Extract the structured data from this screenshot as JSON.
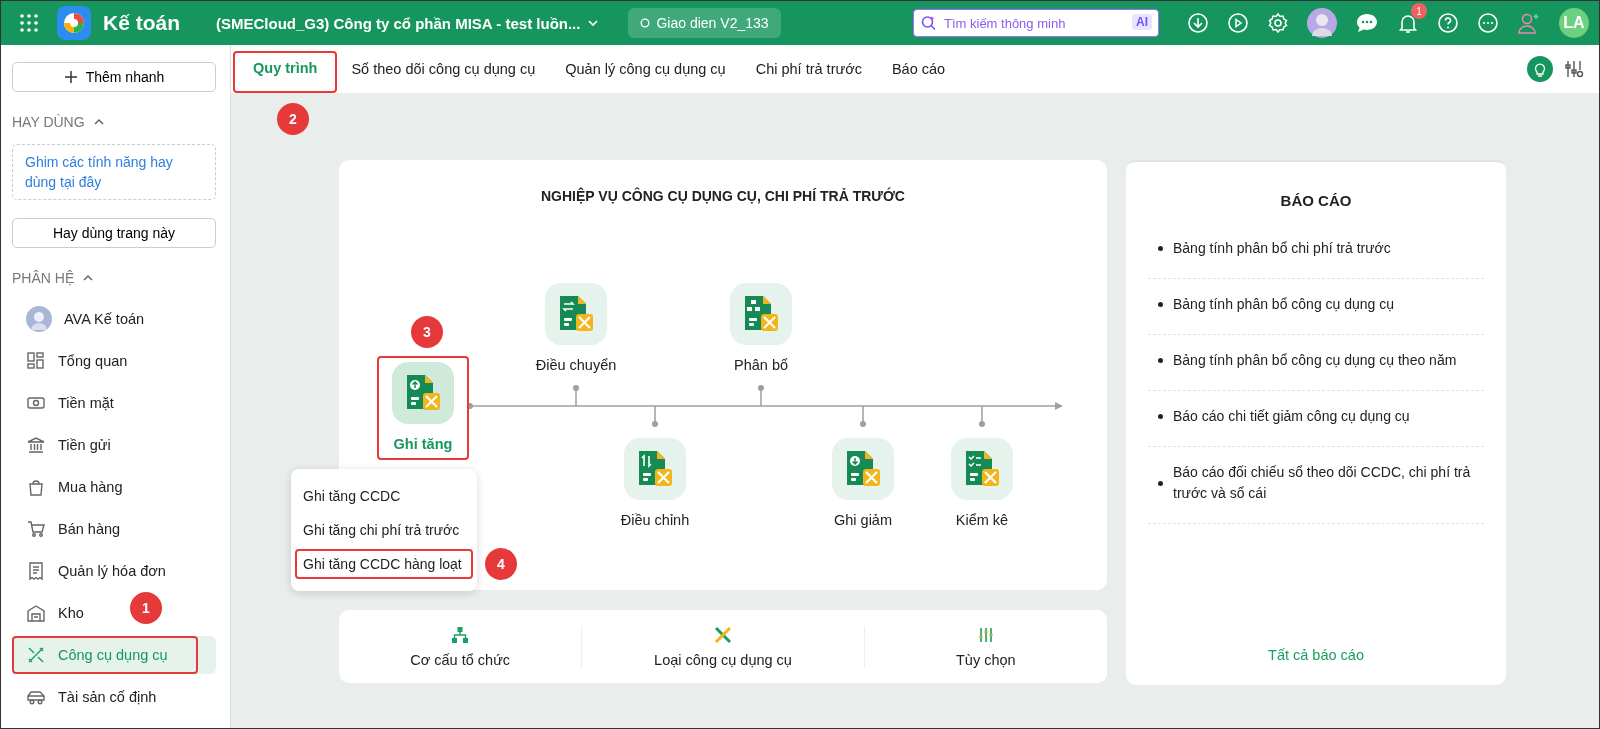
{
  "app": {
    "title": "Kế toán",
    "company": "(SMECloud_G3) Công ty cổ phần MISA - test luồn...",
    "version": "Giao dien V2_133"
  },
  "search": {
    "placeholder": "Tìm kiếm thông minh",
    "badge": "AI"
  },
  "notifications": {
    "count": "1"
  },
  "user": {
    "initials": "LA"
  },
  "sidebar": {
    "quick_add": "Thêm nhanh",
    "favorites": {
      "heading": "HAY DÙNG",
      "expanded": true,
      "hint": "Ghim các tính năng hay dùng tại đây",
      "button": "Hay dùng trang này"
    },
    "modules": {
      "heading": "PHÂN HỆ",
      "expanded": true,
      "items": [
        {
          "label": "AVA Kế toán",
          "selected": false
        },
        {
          "label": "Tổng quan",
          "selected": false
        },
        {
          "label": "Tiền mặt",
          "selected": false
        },
        {
          "label": "Tiền gửi",
          "selected": false
        },
        {
          "label": "Mua hàng",
          "selected": false
        },
        {
          "label": "Bán hàng",
          "selected": false
        },
        {
          "label": "Quản lý hóa đơn",
          "selected": false
        },
        {
          "label": "Kho",
          "selected": false
        },
        {
          "label": "Công cụ dụng cụ",
          "selected": true,
          "callout": "1"
        },
        {
          "label": "Tài sản cố định",
          "selected": false
        }
      ]
    }
  },
  "tabs": [
    {
      "label": "Quy trình",
      "selected": true,
      "callout": "2"
    },
    {
      "label": "Sổ theo dõi công cụ dụng cụ",
      "selected": false
    },
    {
      "label": "Quản lý công cụ dụng cụ",
      "selected": false
    },
    {
      "label": "Chi phí trả trước",
      "selected": false
    },
    {
      "label": "Báo cáo",
      "selected": false
    }
  ],
  "process": {
    "title": "NGHIỆP VỤ CÔNG CỤ DỤNG CỤ, CHI PHÍ TRẢ TRƯỚC",
    "nodes": [
      {
        "label": "Ghi tăng",
        "selected": true,
        "callout": "3"
      },
      {
        "label": "Điều chuyển",
        "selected": false
      },
      {
        "label": "Phân bổ",
        "selected": false
      },
      {
        "label": "Điều chỉnh",
        "selected": false
      },
      {
        "label": "Ghi giảm",
        "selected": false
      },
      {
        "label": "Kiểm kê",
        "selected": false
      }
    ],
    "menu": [
      {
        "label": "Ghi tăng CCDC"
      },
      {
        "label": "Ghi tăng chi phí trả trước"
      },
      {
        "label": "Ghi tăng CCDC hàng loạt",
        "callout": "4"
      }
    ]
  },
  "shortcuts": [
    {
      "label": "Cơ cấu tổ chức"
    },
    {
      "label": "Loại công cụ dụng cụ"
    },
    {
      "label": "Tùy chọn"
    }
  ],
  "reports": {
    "title": "BÁO CÁO",
    "items": [
      "Bảng tính phân bổ chi phí trả trước",
      "Bảng tính phân bổ công cụ dụng cụ",
      "Bảng tính phân bổ công cụ dụng cụ theo năm",
      "Báo cáo chi tiết giảm công cụ dụng cụ",
      "Báo cáo đối chiếu sổ theo dõi CCDC, chi phí trả trước và sổ cái"
    ],
    "link": "Tất cả báo cáo"
  }
}
